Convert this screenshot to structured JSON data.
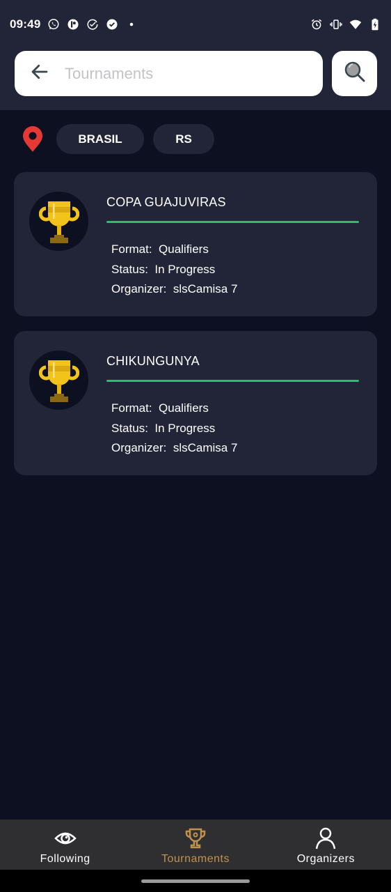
{
  "status_bar": {
    "time": "09:49",
    "left_icons": [
      "whatsapp-icon",
      "app-p-icon",
      "check-circle-outline-icon",
      "check-circle-filled-icon",
      "dot-icon"
    ],
    "right_icons": [
      "alarm-icon",
      "vibrate-icon",
      "wifi-icon",
      "battery-charging-icon"
    ]
  },
  "search": {
    "placeholder": "Tournaments",
    "value": "",
    "back_icon": "arrow-left-icon",
    "search_icon": "magnifier-icon"
  },
  "location_filter": {
    "icon": "map-pin-icon",
    "chips": [
      "BRASIL",
      "RS"
    ]
  },
  "tournaments": [
    {
      "name": "COPA GUAJUVIRAS",
      "icon": "trophy-icon",
      "format_label": "Format:",
      "format": "Qualifiers",
      "status_label": "Status:",
      "status": "In Progress",
      "organizer_label": "Organizer:",
      "organizer": "slsCamisa 7"
    },
    {
      "name": "CHIKUNGUNYA",
      "icon": "trophy-icon",
      "format_label": "Format:",
      "format": "Qualifiers",
      "status_label": "Status:",
      "status": "In Progress",
      "organizer_label": "Organizer:",
      "organizer": "slsCamisa 7"
    }
  ],
  "bottom_nav": {
    "items": [
      {
        "label": "Following",
        "icon": "eye-icon",
        "active": false
      },
      {
        "label": "Tournaments",
        "icon": "trophy-outline-icon",
        "active": true
      },
      {
        "label": "Organizers",
        "icon": "person-icon",
        "active": false
      }
    ]
  },
  "colors": {
    "background": "#0d1020",
    "surface": "#222538",
    "accent_green": "#2ebd6b",
    "active_nav": "#c0924f",
    "pin_red": "#e53935",
    "trophy_gold": "#f2c31b"
  }
}
